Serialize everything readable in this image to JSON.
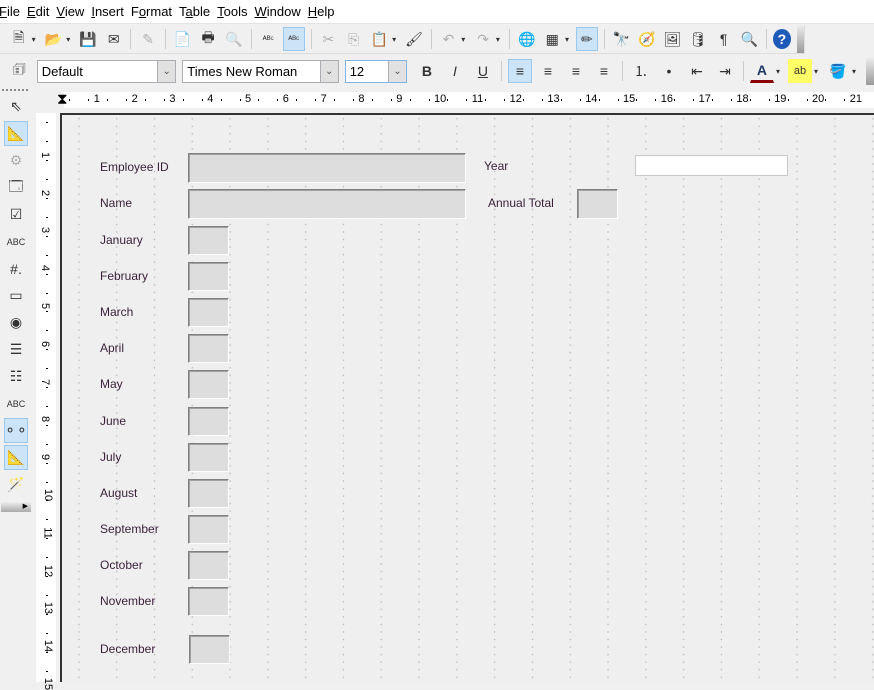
{
  "menu": [
    {
      "pre": "",
      "ul": "F",
      "post": "ile"
    },
    {
      "pre": "",
      "ul": "E",
      "post": "dit"
    },
    {
      "pre": "",
      "ul": "V",
      "post": "iew"
    },
    {
      "pre": "",
      "ul": "I",
      "post": "nsert"
    },
    {
      "pre": "F",
      "ul": "o",
      "post": "rmat"
    },
    {
      "pre": "T",
      "ul": "a",
      "post": "ble"
    },
    {
      "pre": "",
      "ul": "T",
      "post": "ools"
    },
    {
      "pre": "",
      "ul": "W",
      "post": "indow"
    },
    {
      "pre": "",
      "ul": "H",
      "post": "elp"
    }
  ],
  "toolbar1": [
    {
      "icon": "new-document-icon",
      "g": "🗎",
      "dd": true
    },
    {
      "icon": "open-folder-icon",
      "g": "📂",
      "dd": true
    },
    {
      "icon": "save-icon",
      "g": "💾"
    },
    {
      "icon": "email-icon",
      "g": "✉"
    },
    {
      "sep": true
    },
    {
      "icon": "edit-mode-icon",
      "g": "✎",
      "dis": true
    },
    {
      "sep": true
    },
    {
      "icon": "export-pdf-icon",
      "g": "📄"
    },
    {
      "icon": "print-icon",
      "g": "🖶"
    },
    {
      "icon": "print-preview-icon",
      "g": "🔍",
      "dis": true
    },
    {
      "sep": true
    },
    {
      "icon": "spellcheck-icon",
      "g": "ᴬᴮᶜ"
    },
    {
      "icon": "autospellcheck-icon",
      "g": "ᴬᴮᶜ",
      "active": true
    },
    {
      "sep": true
    },
    {
      "icon": "cut-icon",
      "g": "✂",
      "dis": true
    },
    {
      "icon": "copy-icon",
      "g": "⎘",
      "dis": true
    },
    {
      "icon": "paste-icon",
      "g": "📋",
      "dd": true
    },
    {
      "icon": "clone-formatting-icon",
      "g": "🖌"
    },
    {
      "sep": true
    },
    {
      "icon": "undo-icon",
      "g": "↶",
      "dis": true,
      "dd": true
    },
    {
      "icon": "redo-icon",
      "g": "↷",
      "dis": true,
      "dd": true
    },
    {
      "sep": true
    },
    {
      "icon": "hyperlink-icon",
      "g": "🌐"
    },
    {
      "icon": "table-icon",
      "g": "▦",
      "dd": true
    },
    {
      "icon": "show-draw-functions-icon",
      "g": "✏",
      "active": true
    },
    {
      "sep": true
    },
    {
      "icon": "find-replace-icon",
      "g": "🔭"
    },
    {
      "icon": "navigator-icon",
      "g": "🧭"
    },
    {
      "icon": "gallery-icon",
      "g": "🖼"
    },
    {
      "icon": "data-sources-icon",
      "g": "🛢"
    },
    {
      "icon": "formatting-marks-icon",
      "g": "¶"
    },
    {
      "icon": "zoom-icon",
      "g": "🔍"
    },
    {
      "sep": true
    },
    {
      "icon": "help-icon",
      "g": "?"
    }
  ],
  "formatting": {
    "style": "Default",
    "font": "Times New Roman",
    "size": "12"
  },
  "toolbar2": [
    {
      "icon": "bold-icon",
      "g": "B"
    },
    {
      "icon": "italic-icon",
      "g": "I"
    },
    {
      "icon": "underline-icon",
      "g": "U"
    },
    {
      "sep": true
    },
    {
      "icon": "align-left-icon",
      "g": "≡",
      "active": true
    },
    {
      "icon": "align-center-icon",
      "g": "≡"
    },
    {
      "icon": "align-right-icon",
      "g": "≡"
    },
    {
      "icon": "justify-icon",
      "g": "≡"
    },
    {
      "sep": true
    },
    {
      "icon": "numbering-icon",
      "g": "⒈"
    },
    {
      "icon": "bullets-icon",
      "g": "•"
    },
    {
      "icon": "decrease-indent-icon",
      "g": "⇤"
    },
    {
      "icon": "increase-indent-icon",
      "g": "⇥"
    },
    {
      "sep": true
    },
    {
      "icon": "font-color-icon",
      "g": "A",
      "dd": true
    },
    {
      "icon": "highlighting-icon",
      "g": "ab",
      "dd": true
    },
    {
      "icon": "background-color-icon",
      "g": "🪣",
      "dd": true
    }
  ],
  "formControls": [
    {
      "icon": "select-icon",
      "g": "⇖"
    },
    {
      "icon": "design-mode-icon",
      "g": "📐",
      "active": true
    },
    {
      "icon": "control-properties-icon",
      "g": "⚙",
      "dis": true
    },
    {
      "icon": "form-properties-icon",
      "g": "🗔"
    },
    {
      "icon": "checkbox-icon",
      "g": "☑"
    },
    {
      "icon": "text-box-icon",
      "g": "ABC"
    },
    {
      "icon": "formatted-field-icon",
      "g": "#."
    },
    {
      "icon": "push-button-icon",
      "g": "▭"
    },
    {
      "icon": "option-button-icon",
      "g": "◉"
    },
    {
      "icon": "list-box-icon",
      "g": "☰"
    },
    {
      "icon": "combo-box-icon",
      "g": "☷"
    },
    {
      "icon": "label-field-icon",
      "g": "ABC"
    },
    {
      "icon": "more-controls-icon",
      "g": "⚬⚬",
      "active": true
    },
    {
      "icon": "form-design-icon",
      "g": "📐",
      "active": true
    },
    {
      "icon": "wizards-icon",
      "g": "🪄"
    }
  ],
  "ruler": {
    "h": [
      "1",
      "2",
      "3",
      "4",
      "5",
      "6",
      "7",
      "8",
      "9",
      "10",
      "11",
      "12",
      "13",
      "14",
      "15",
      "16",
      "17",
      "18",
      "19",
      "20",
      "21"
    ],
    "v": [
      "1",
      "2",
      "3",
      "4",
      "5",
      "6",
      "7",
      "8",
      "9",
      "10",
      "11",
      "12",
      "13",
      "14",
      "15"
    ]
  },
  "form": {
    "employee_id": "Employee ID",
    "name": "Name",
    "year": "Year",
    "annual_total": "Annual Total",
    "months": [
      "January",
      "February",
      "March",
      "April",
      "May",
      "June",
      "July",
      "August",
      "September",
      "October",
      "November",
      "December"
    ]
  }
}
